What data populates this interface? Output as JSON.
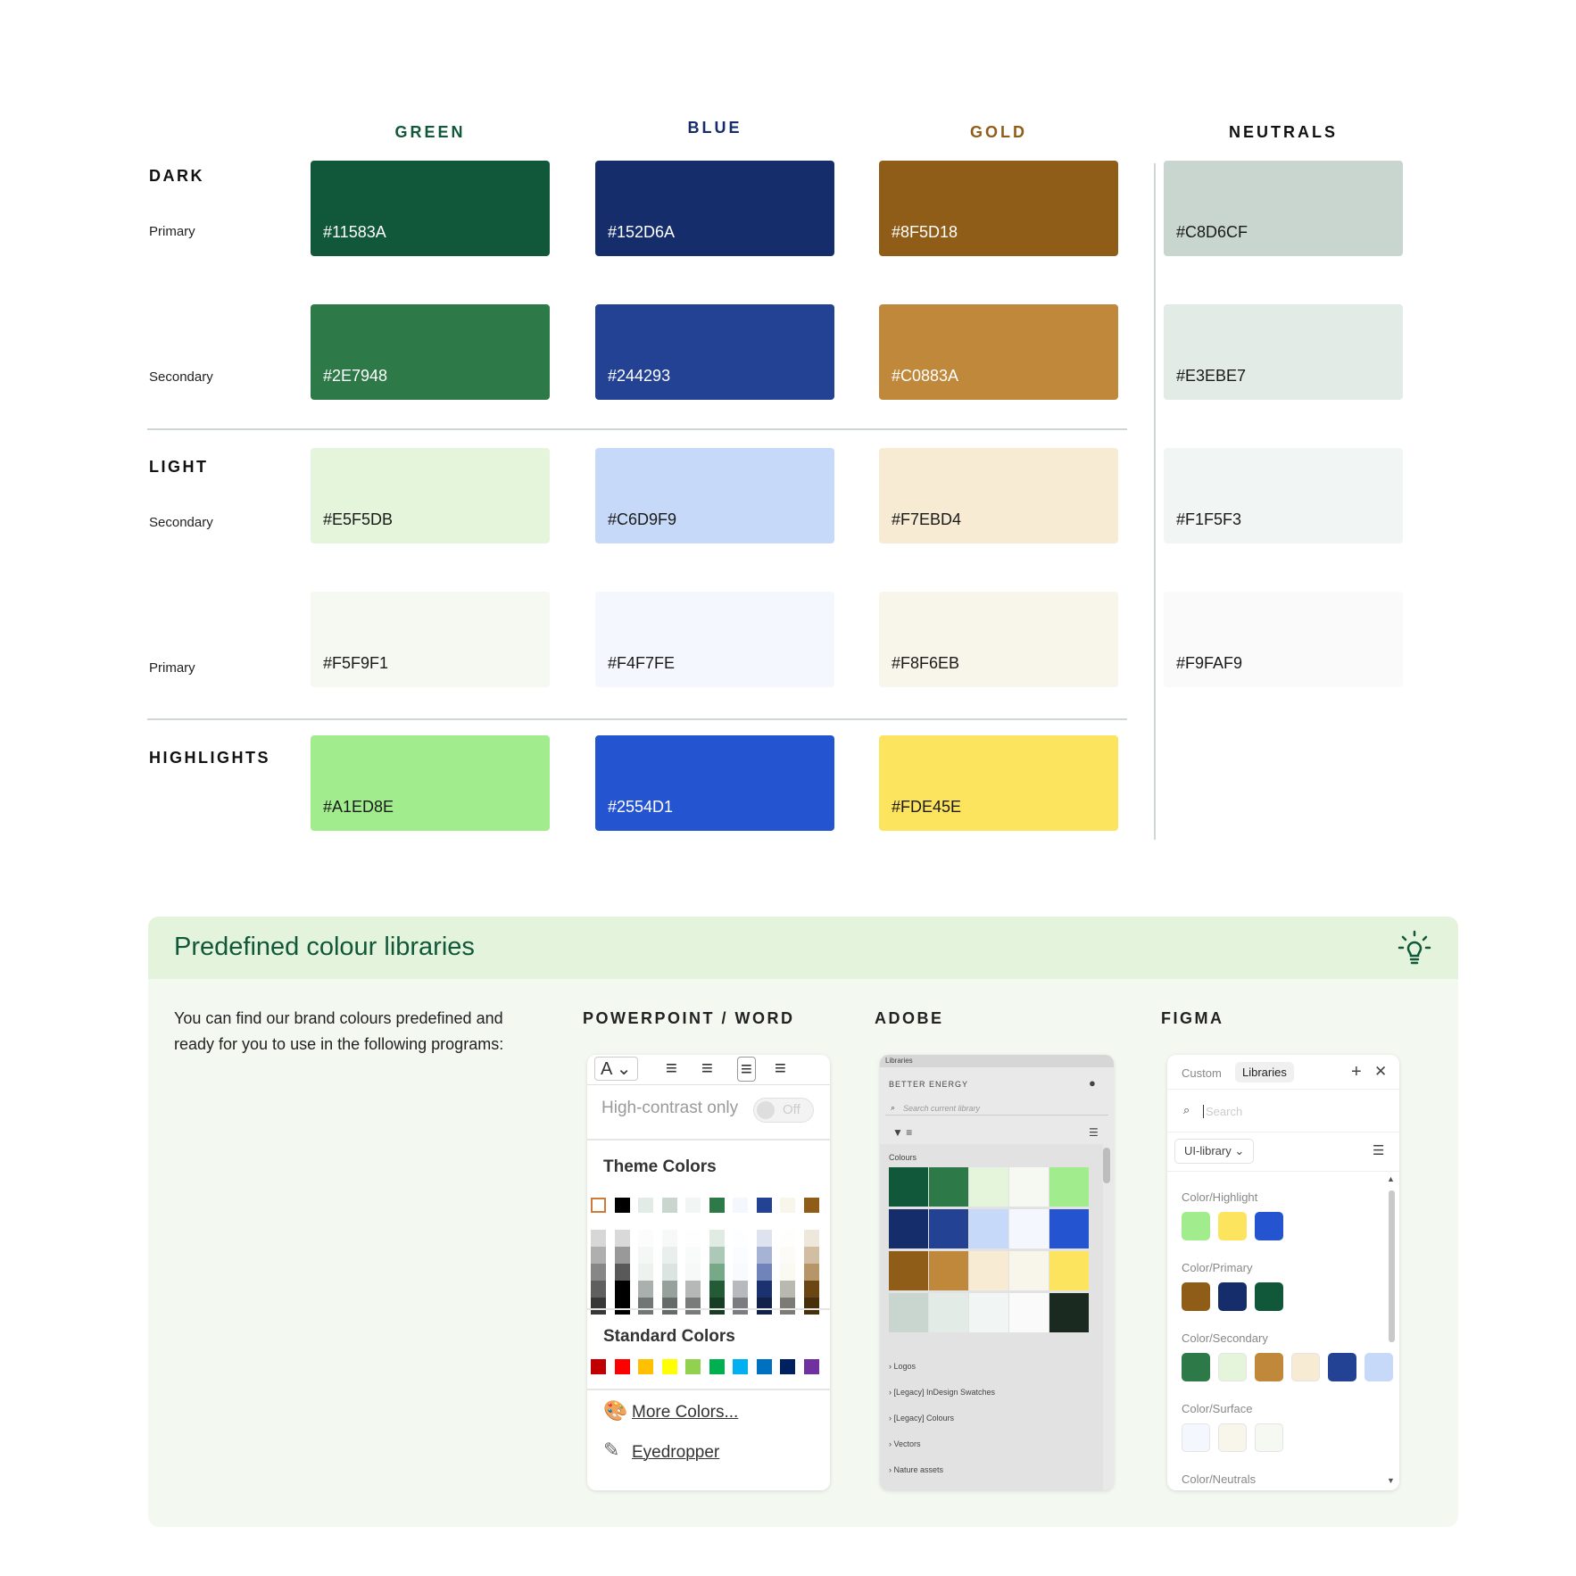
{
  "columns": {
    "green": {
      "label": "GREEN",
      "color": "#11583a"
    },
    "blue": {
      "label": "BLUE",
      "color": "#152d6a"
    },
    "gold": {
      "label": "GOLD",
      "color": "#8f5d18"
    },
    "neutrals": {
      "label": "NEUTRALS",
      "color": "#111111"
    }
  },
  "sections": {
    "dark": "DARK",
    "light": "LIGHT",
    "highlights": "HIGHLIGHTS"
  },
  "row_labels": {
    "dark_primary": "Primary",
    "dark_secondary": "Secondary",
    "light_secondary": "Secondary",
    "light_primary": "Primary"
  },
  "swatches": {
    "dark_primary": [
      "#11583A",
      "#152D6A",
      "#8F5D18",
      "#C8D6CF"
    ],
    "dark_secondary": [
      "#2E7948",
      "#244293",
      "#C0883A",
      "#E3EBE7"
    ],
    "light_secondary": [
      "#E5F5DB",
      "#C6D9F9",
      "#F7EBD4",
      "#F1F5F3"
    ],
    "light_primary": [
      "#F5F9F1",
      "#F4F7FE",
      "#F8F6EB",
      "#F9FAF9"
    ],
    "highlights": [
      "#A1ED8E",
      "#2554D1",
      "#FDE45E"
    ]
  },
  "library": {
    "title": "Predefined colour libraries",
    "description": "You can find our brand colours predefined and ready for you to use in the following programs:",
    "programs": {
      "ppt": "POWERPOINT / WORD",
      "adobe": "ADOBE",
      "figma": "FIGMA"
    }
  },
  "ppt": {
    "high_contrast": "High-contrast only",
    "toggle_state": "Off",
    "theme_colors": "Theme Colors",
    "standard_colors": "Standard Colors",
    "more_colors": "More Colors...",
    "eyedropper": "Eyedropper",
    "theme_swatches": [
      "#ffffff",
      "#000000",
      "#e3ebe7",
      "#c8d6cf",
      "#f1f5f3",
      "#2e7948",
      "#f4f7fe",
      "#244293",
      "#f8f6eb",
      "#8f5d18"
    ],
    "standard_swatches": [
      "#c00000",
      "#ff0000",
      "#ffc000",
      "#ffff00",
      "#92d050",
      "#00b050",
      "#00b0f0",
      "#0070c0",
      "#002060",
      "#7030a0"
    ]
  },
  "adobe": {
    "tab": "Libraries",
    "library_name": "BETTER ENERGY",
    "search_placeholder": "Search current library",
    "group": "Colours",
    "grid": [
      [
        "#11583a",
        "#2e7948",
        "#e5f5db",
        "#f5f9f1",
        "#a1ed8e"
      ],
      [
        "#152d6a",
        "#244293",
        "#c6d9f9",
        "#f4f7fe",
        "#2554d1"
      ],
      [
        "#8f5d18",
        "#c0883a",
        "#f7ebd4",
        "#f8f6eb",
        "#fde45e"
      ],
      [
        "#c8d6cf",
        "#e3ebe7",
        "#f1f5f3",
        "#f9faf9",
        "#1a2a20"
      ]
    ],
    "groups": [
      "Logos",
      "[Legacy] InDesign Swatches",
      "[Legacy] Colours",
      "Vectors",
      "Nature assets"
    ]
  },
  "figma": {
    "tab_custom": "Custom",
    "tab_libraries": "Libraries",
    "search_placeholder": "Search",
    "library_select": "UI-library",
    "groups": [
      {
        "name": "Color/Highlight",
        "swatches": [
          "#a1ed8e",
          "#fde45e",
          "#2554d1"
        ]
      },
      {
        "name": "Color/Primary",
        "swatches": [
          "#8f5d18",
          "#152d6a",
          "#11583a"
        ]
      },
      {
        "name": "Color/Secondary",
        "swatches": [
          "#2e7948",
          "#e5f5db",
          "#c0883a",
          "#f7ebd4",
          "#244293",
          "#c6d9f9"
        ]
      },
      {
        "name": "Color/Surface",
        "swatches": [
          "#f4f7fe",
          "#f8f6eb",
          "#f5f9f1"
        ]
      },
      {
        "name": "Color/Neutrals",
        "swatches": []
      }
    ]
  }
}
